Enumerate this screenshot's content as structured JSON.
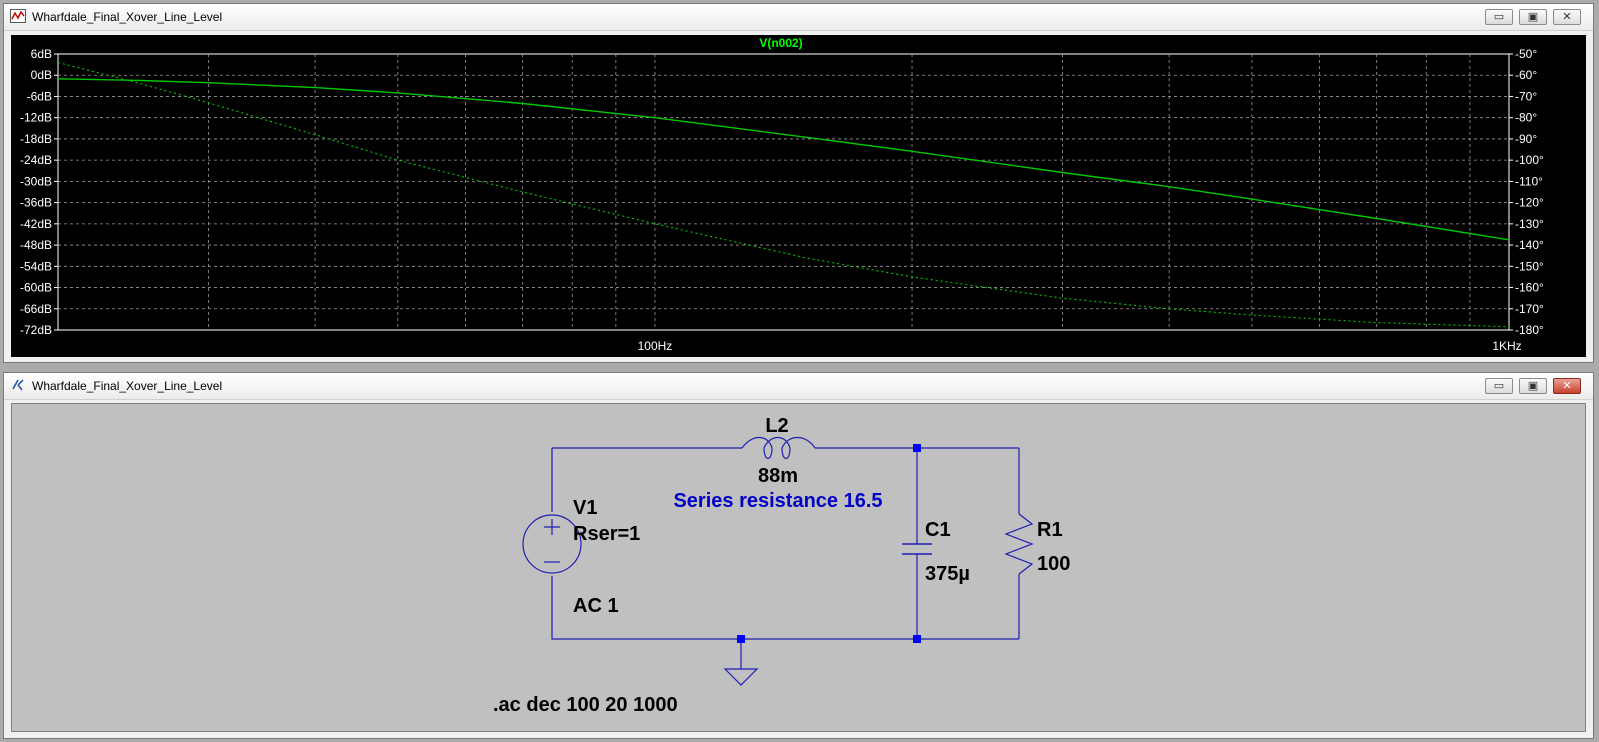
{
  "plot_window": {
    "title": "Wharfdale_Final_Xover_Line_Level",
    "buttons": {
      "minimize": "▭",
      "restore": "▣",
      "close": "✕"
    }
  },
  "schematic_window": {
    "title": "Wharfdale_Final_Xover_Line_Level",
    "buttons": {
      "minimize": "▭",
      "restore": "▣",
      "close": "✕"
    }
  },
  "chart_data": {
    "type": "line",
    "title": "V(n002)",
    "x_scale": "log",
    "xlim": [
      20,
      1000
    ],
    "x_tick_labels": [
      {
        "value": 100,
        "label": "100Hz"
      },
      {
        "value": 1000,
        "label": "1KHz"
      }
    ],
    "y_left_ticks": [
      {
        "value": 6,
        "label": "6dB"
      },
      {
        "value": 0,
        "label": "0dB"
      },
      {
        "value": -6,
        "label": "-6dB"
      },
      {
        "value": -12,
        "label": "-12dB"
      },
      {
        "value": -18,
        "label": "-18dB"
      },
      {
        "value": -24,
        "label": "-24dB"
      },
      {
        "value": -30,
        "label": "-30dB"
      },
      {
        "value": -36,
        "label": "-36dB"
      },
      {
        "value": -42,
        "label": "-42dB"
      },
      {
        "value": -48,
        "label": "-48dB"
      },
      {
        "value": -54,
        "label": "-54dB"
      },
      {
        "value": -60,
        "label": "-60dB"
      },
      {
        "value": -66,
        "label": "-66dB"
      },
      {
        "value": -72,
        "label": "-72dB"
      }
    ],
    "ylim_left": [
      -72,
      6
    ],
    "y_right_ticks": [
      {
        "value": -50,
        "label": "-50°"
      },
      {
        "value": -60,
        "label": "-60°"
      },
      {
        "value": -70,
        "label": "-70°"
      },
      {
        "value": -80,
        "label": "-80°"
      },
      {
        "value": -90,
        "label": "-90°"
      },
      {
        "value": -100,
        "label": "-100°"
      },
      {
        "value": -110,
        "label": "-110°"
      },
      {
        "value": -120,
        "label": "-120°"
      },
      {
        "value": -130,
        "label": "-130°"
      },
      {
        "value": -140,
        "label": "-140°"
      },
      {
        "value": -150,
        "label": "-150°"
      },
      {
        "value": -160,
        "label": "-160°"
      },
      {
        "value": -170,
        "label": "-170°"
      },
      {
        "value": -180,
        "label": "-180°"
      }
    ],
    "ylim_right": [
      -180,
      -50
    ],
    "grid": true,
    "colors": {
      "background": "#000000",
      "trace": "#00c800",
      "grid": "#9a9a9a",
      "title": "#00ff00",
      "axis_text": "#ffffff"
    },
    "series": [
      {
        "axis": "left",
        "style": "solid",
        "x": [
          20,
          25,
          30,
          40,
          50,
          70,
          100,
          150,
          200,
          300,
          400,
          500,
          700,
          1000
        ],
        "y": [
          -1.0,
          -1.5,
          -2.1,
          -3.5,
          -5.0,
          -8.0,
          -12.0,
          -17.5,
          -21.5,
          -27.5,
          -31.5,
          -35.0,
          -40.5,
          -46.5
        ]
      },
      {
        "axis": "right",
        "style": "dashed",
        "x": [
          20,
          25,
          30,
          40,
          50,
          70,
          100,
          150,
          200,
          300,
          400,
          500,
          700,
          1000
        ],
        "y": [
          -54.0,
          -64.0,
          -73.0,
          -88.0,
          -100.0,
          -115.0,
          -130.0,
          -146.0,
          -155.0,
          -165.0,
          -170.0,
          -173.0,
          -176.5,
          -178.5
        ]
      }
    ]
  },
  "schematic": {
    "colors": {
      "wire": "#1e1eb4",
      "component": "#1e1eb4",
      "junction": "#0000ff",
      "label": "#000000",
      "comment": "#0000c8"
    },
    "L2": {
      "name": "L2",
      "value": "88m"
    },
    "comment": "Series resistance 16.5",
    "V1": {
      "name": "V1",
      "param": "Rser=1",
      "value": "AC 1"
    },
    "C1": {
      "name": "C1",
      "value": "375µ"
    },
    "R1": {
      "name": "R1",
      "value": "100"
    },
    "directive": ".ac dec 100 20 1000"
  }
}
